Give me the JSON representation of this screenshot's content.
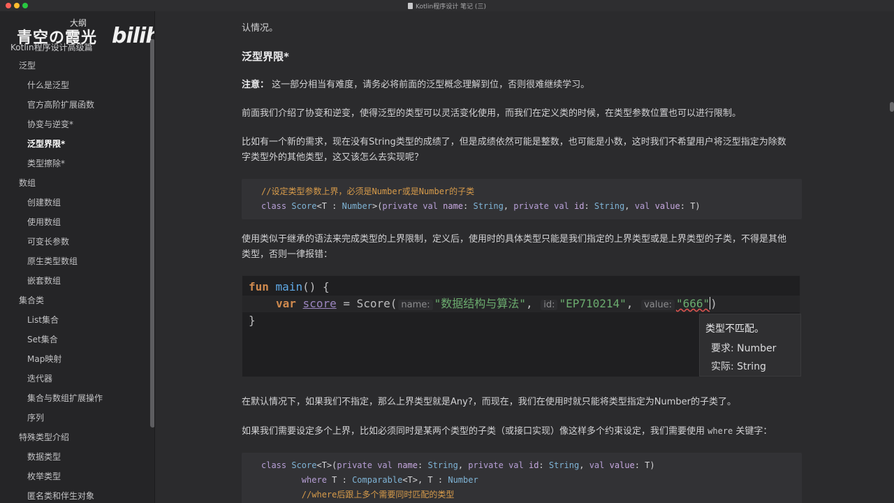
{
  "window": {
    "title": "Kotlin程序设计 笔记 (三)"
  },
  "watermark": {
    "channel": "青空の霞光",
    "outline": "大纲",
    "site": "bilibili"
  },
  "sidebar": {
    "book_title": "Kotlin程序设计高级篇",
    "items": [
      {
        "label": "泛型",
        "level": 1
      },
      {
        "label": "什么是泛型",
        "level": 2
      },
      {
        "label": "官方高阶扩展函数",
        "level": 2
      },
      {
        "label": "协变与逆变*",
        "level": 2
      },
      {
        "label": "泛型界限*",
        "level": 2,
        "active": true
      },
      {
        "label": "类型擦除*",
        "level": 2
      },
      {
        "label": "数组",
        "level": 1
      },
      {
        "label": "创建数组",
        "level": 2
      },
      {
        "label": "使用数组",
        "level": 2
      },
      {
        "label": "可变长参数",
        "level": 2
      },
      {
        "label": "原生类型数组",
        "level": 2
      },
      {
        "label": "嵌套数组",
        "level": 2
      },
      {
        "label": "集合类",
        "level": 1
      },
      {
        "label": "List集合",
        "level": 2
      },
      {
        "label": "Set集合",
        "level": 2
      },
      {
        "label": "Map映射",
        "level": 2
      },
      {
        "label": "迭代器",
        "level": 2
      },
      {
        "label": "集合与数组扩展操作",
        "level": 2
      },
      {
        "label": "序列",
        "level": 2
      },
      {
        "label": "特殊类型介绍",
        "level": 1
      },
      {
        "label": "数据类型",
        "level": 2
      },
      {
        "label": "枚举类型",
        "level": 2
      },
      {
        "label": "匿名类和伴生对象",
        "level": 2
      }
    ]
  },
  "content": {
    "top_cut_line": "认情况。",
    "heading": "泛型界限*",
    "note_label": "注意：",
    "note_text": "这一部分相当有难度，请务必将前面的泛型概念理解到位，否则很难继续学习。",
    "para1": "前面我们介绍了协变和逆变，使得泛型的类型可以灵活变化使用，而我们在定义类的时候，在类型参数位置也可以进行限制。",
    "para2_line1": "比如有一个新的需求，现在没有String类型的成绩了，但是成绩依然可能是整数，也可能是小数，这时我们不希望用户将泛型指定为除数",
    "para2_line2": "字类型外的其他类型，这又该怎么去实现呢？",
    "code1": {
      "comment": "//设定类型参数上界，必须是Number或是Number的子类",
      "line": "class Score<T : Number>(private val name: String, private val id: String, val value: T)"
    },
    "para3_line1": "使用类似于继承的语法来完成类型的上界限制，定义后，使用时的具体类型只能是我们指定的上界类型或是上界类型的子类，不得是其他",
    "para3_line2": "类型，否则一律报错：",
    "ide": {
      "line1_kw": "fun",
      "line1_fn": "main",
      "line1_rest": "() {",
      "line2_kw": "var",
      "line2_var": "score",
      "line2_call": " = Score(",
      "hint_name": "name:",
      "arg_name": "\"数据结构与算法\"",
      "hint_id": "id:",
      "arg_id": "\"EP710214\"",
      "hint_value": "value:",
      "arg_value": "\"666\"",
      "line3": "}",
      "tooltip_title": "类型不匹配。",
      "tooltip_required": "要求: Number",
      "tooltip_actual": "实际: String"
    },
    "para4": "在默认情况下，如果我们不指定，那么上界类型就是Any?，而现在，我们在使用时就只能将类型指定为Number的子类了。",
    "para5_pre": "如果我们需要设定多个上界，比如必须同时是某两个类型的子类（或接口实现）像这样多个约束设定，我们需要使用",
    "para5_kw": "where",
    "para5_post": "关键字：",
    "code3": {
      "line1": "class Score<T>(private val name: String, private val id: String, val value: T)",
      "line2": "        where T : Comparable<T>, T : Number",
      "line3": "        //where后跟上多个需要同时匹配的类型"
    }
  }
}
